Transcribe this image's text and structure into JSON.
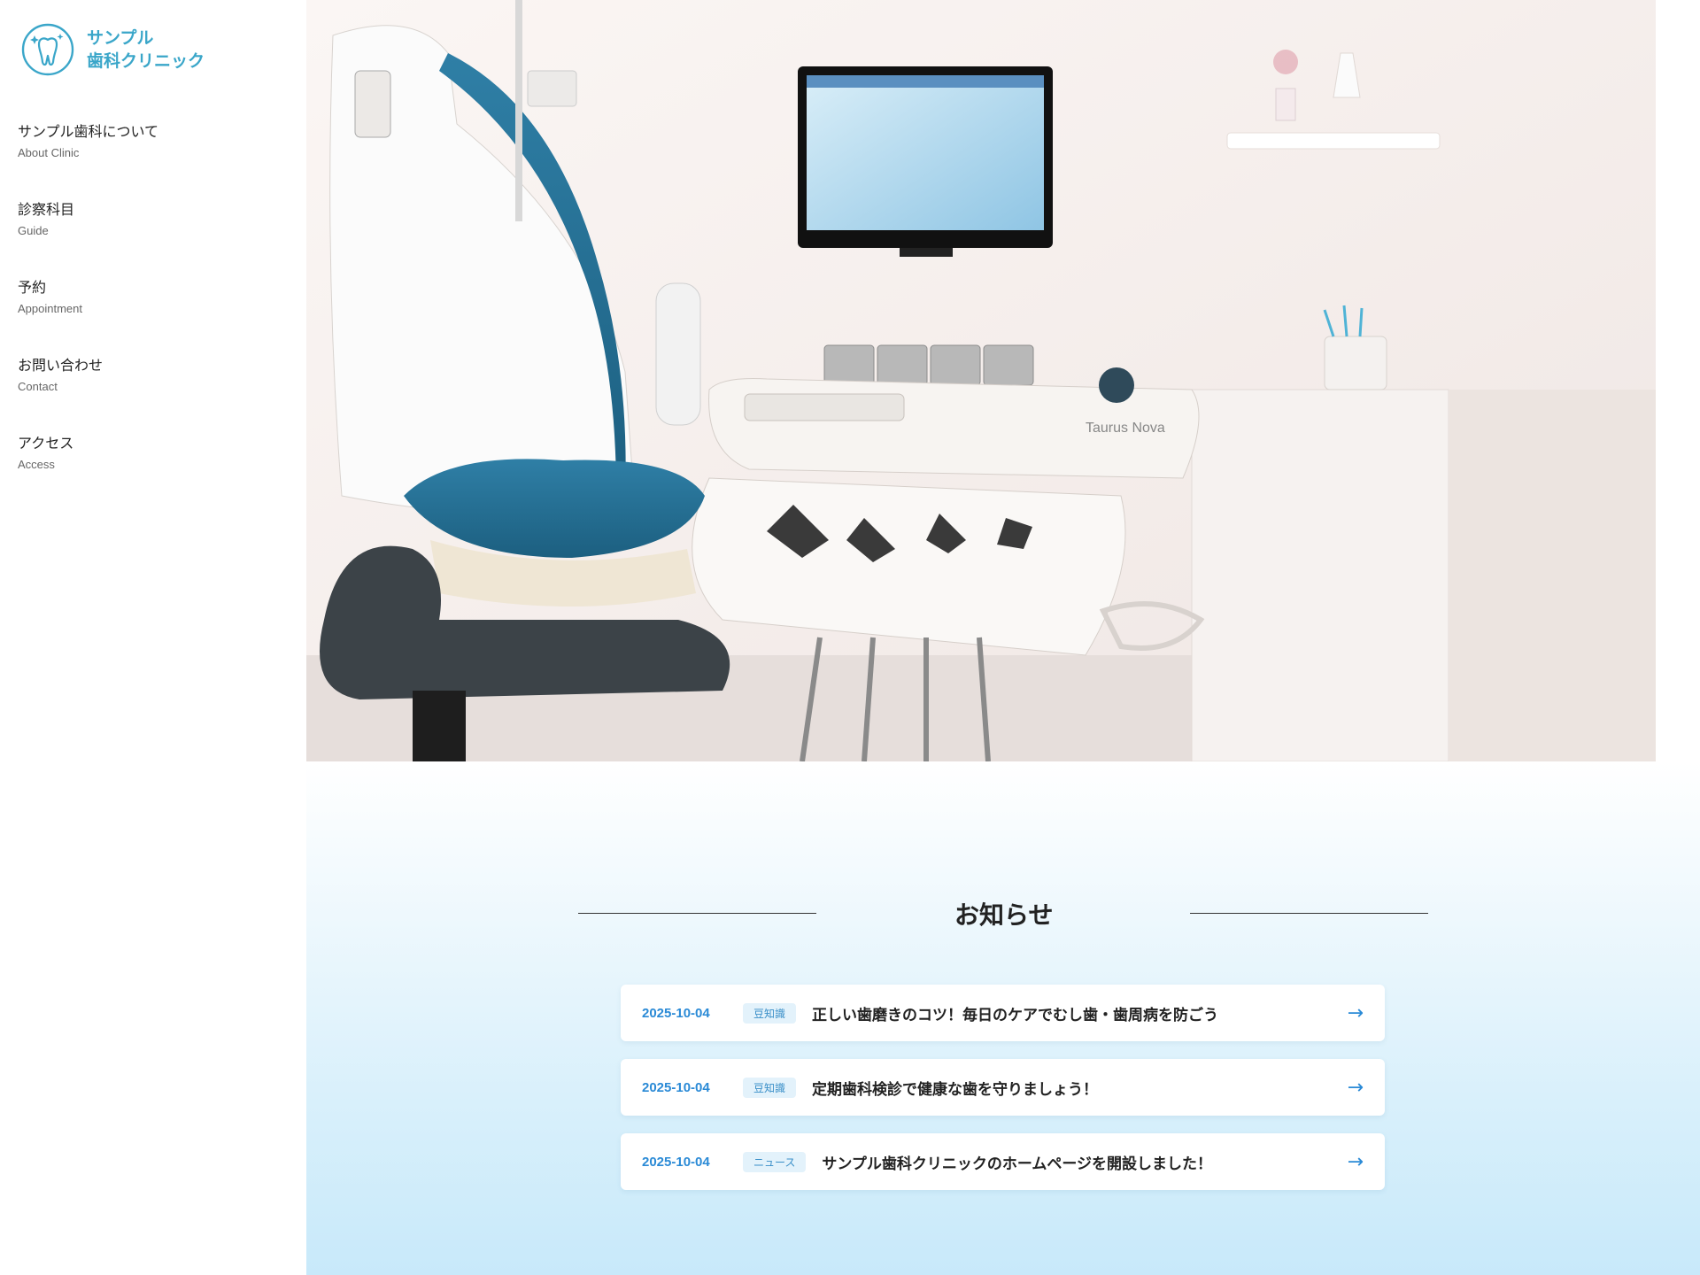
{
  "brand": {
    "line1": "サンプル",
    "line2": "歯科クリニック",
    "color": "#3aa6c9",
    "icon": "tooth-sparkle-icon"
  },
  "nav": [
    {
      "ja": "サンプル歯科について",
      "en": "About Clinic"
    },
    {
      "ja": "診察科目",
      "en": "Guide"
    },
    {
      "ja": "予約",
      "en": "Appointment"
    },
    {
      "ja": "お問い合わせ",
      "en": "Contact"
    },
    {
      "ja": "アクセス",
      "en": "Access"
    }
  ],
  "hero": {
    "equipment_brand": "Taurus Nova"
  },
  "news": {
    "title": "お知らせ",
    "items": [
      {
        "date": "2025-10-04",
        "tag": "豆知識",
        "text": "正しい歯磨きのコツ！毎日のケアでむし歯・歯周病を防ごう",
        "arrow": "→"
      },
      {
        "date": "2025-10-04",
        "tag": "豆知識",
        "text": "定期歯科検診で健康な歯を守りましょう！",
        "arrow": "→"
      },
      {
        "date": "2025-10-04",
        "tag": "ニュース",
        "text": "サンプル歯科クリニックのホームページを開設しました！",
        "arrow": "→"
      }
    ]
  },
  "colors": {
    "accent": "#2a8ad6",
    "tag_bg": "#e3f2fb",
    "section_gradient_end": "#c8e9fa"
  }
}
